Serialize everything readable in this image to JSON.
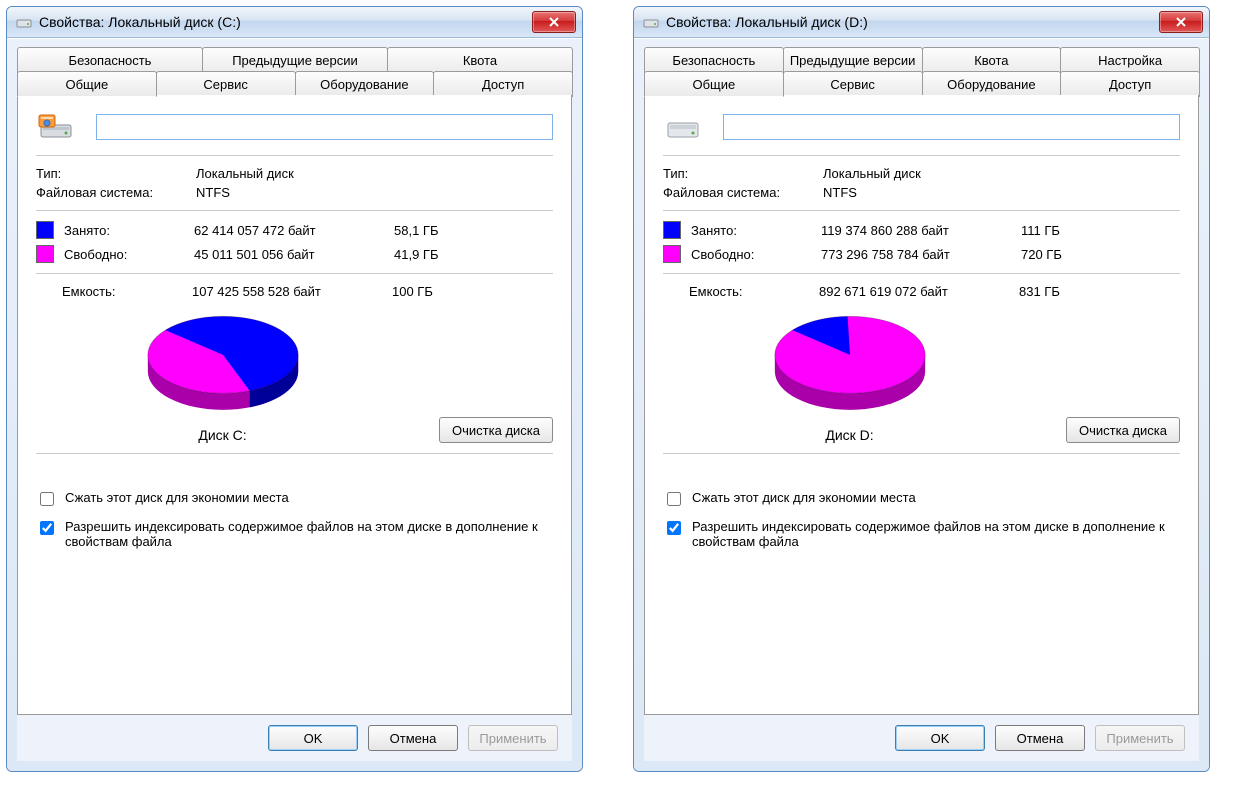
{
  "windows": [
    {
      "id": "c",
      "title": "Свойства: Локальный диск (C:)",
      "tabs_top": [
        "Безопасность",
        "Предыдущие версии",
        "Квота"
      ],
      "tabs_bottom": [
        "Общие",
        "Сервис",
        "Оборудование",
        "Доступ"
      ],
      "active_tab": "Общие",
      "icon_variant": "c",
      "drive_name": "",
      "labels": {
        "type": "Тип:",
        "type_value": "Локальный диск",
        "fs": "Файловая система:",
        "fs_value": "NTFS",
        "used": "Занято:",
        "free": "Свободно:",
        "capacity": "Емкость:",
        "disk_label": "Диск C:",
        "cleanup": "Очистка диска",
        "compress": "Сжать этот диск для экономии места",
        "index": "Разрешить индексировать содержимое файлов на этом диске в дополнение к свойствам файла",
        "ok": "OK",
        "cancel": "Отмена",
        "apply": "Применить"
      },
      "usage": {
        "used_bytes": "62 414 057 472 байт",
        "used_gb": "58,1 ГБ",
        "free_bytes": "45 011 501 056 байт",
        "free_gb": "41,9 ГБ",
        "capacity_bytes": "107 425 558 528 байт",
        "capacity_gb": "100 ГБ"
      },
      "checks": {
        "compress": false,
        "index": true
      },
      "colors": {
        "used": "#0000ff",
        "free": "#ff00ff",
        "side_used": "#000099",
        "side_free": "#aa00aa"
      },
      "chart_data": {
        "type": "pie",
        "title": "Диск C:",
        "series": [
          {
            "name": "Занято",
            "value": 62414057472,
            "display": "58,1 ГБ",
            "color": "#0000ff"
          },
          {
            "name": "Свободно",
            "value": 45011501056,
            "display": "41,9 ГБ",
            "color": "#ff00ff"
          }
        ],
        "total": 107425558528
      }
    },
    {
      "id": "d",
      "title": "Свойства: Локальный диск (D:)",
      "tabs_top": [
        "Безопасность",
        "Предыдущие версии",
        "Квота",
        "Настройка"
      ],
      "tabs_bottom": [
        "Общие",
        "Сервис",
        "Оборудование",
        "Доступ"
      ],
      "active_tab": "Общие",
      "icon_variant": "d",
      "drive_name": "",
      "labels": {
        "type": "Тип:",
        "type_value": "Локальный диск",
        "fs": "Файловая система:",
        "fs_value": "NTFS",
        "used": "Занято:",
        "free": "Свободно:",
        "capacity": "Емкость:",
        "disk_label": "Диск D:",
        "cleanup": "Очистка диска",
        "compress": "Сжать этот диск для экономии места",
        "index": "Разрешить индексировать содержимое файлов на этом диске в дополнение к свойствам файла",
        "ok": "OK",
        "cancel": "Отмена",
        "apply": "Применить"
      },
      "usage": {
        "used_bytes": "119 374 860 288 байт",
        "used_gb": "111 ГБ",
        "free_bytes": "773 296 758 784 байт",
        "free_gb": "720 ГБ",
        "capacity_bytes": "892 671 619 072 байт",
        "capacity_gb": "831 ГБ"
      },
      "checks": {
        "compress": false,
        "index": true
      },
      "colors": {
        "used": "#0000ff",
        "free": "#ff00ff",
        "side_used": "#000099",
        "side_free": "#aa00aa"
      },
      "chart_data": {
        "type": "pie",
        "title": "Диск D:",
        "series": [
          {
            "name": "Занято",
            "value": 119374860288,
            "display": "111 ГБ",
            "color": "#0000ff"
          },
          {
            "name": "Свободно",
            "value": 773296758784,
            "display": "720 ГБ",
            "color": "#ff00ff"
          }
        ],
        "total": 892671619072
      }
    }
  ]
}
